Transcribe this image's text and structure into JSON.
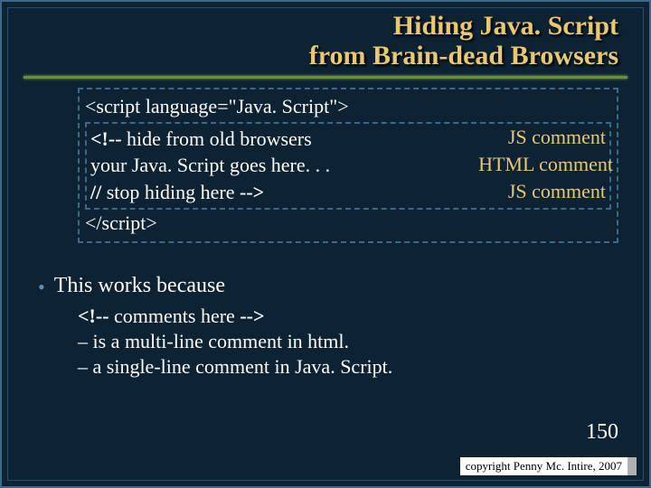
{
  "title_line1": "Hiding Java. Script",
  "title_line2": "from Brain-dead Browsers",
  "code": {
    "open": "<script  language=\"Java. Script\">",
    "hide_prefix": "<!--",
    "hide_text": " hide from old browsers",
    "body": "your Java. Script goes here. . .",
    "stop_prefix": "//",
    "stop_mid": " stop hiding here ",
    "stop_suffix": "-->",
    "close": "</script>"
  },
  "annotations": {
    "js1": "JS comment",
    "html": "HTML comment",
    "js2": "JS comment"
  },
  "bullet": "This works because",
  "sub": {
    "code_open": "<!--",
    "code_mid": " comments here ",
    "code_close": "-->",
    "line1": "– is a multi-line comment in html.",
    "line2": "– a single-line comment in Java. Script."
  },
  "page": "150",
  "copyright": "copyright Penny Mc. Intire, 2007"
}
